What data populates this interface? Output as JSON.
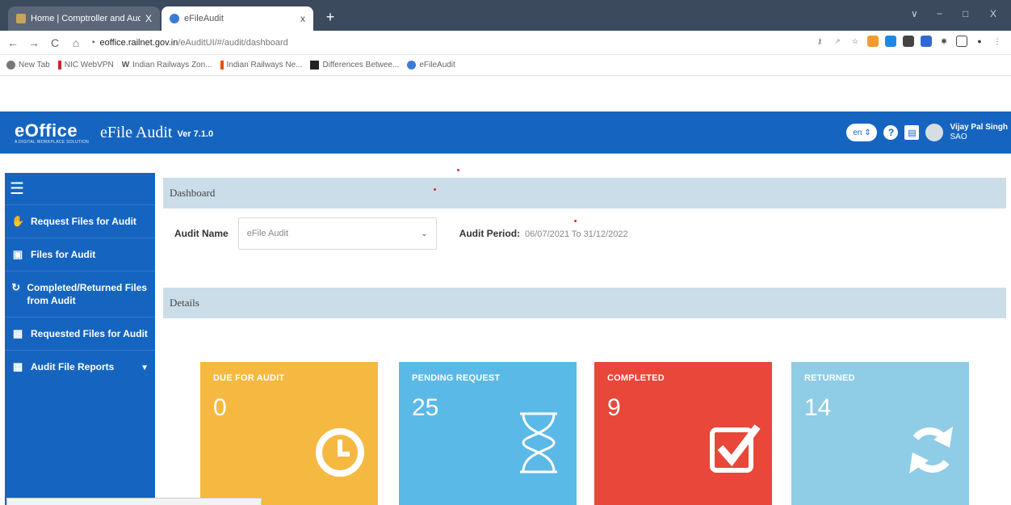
{
  "browser": {
    "tabs": [
      {
        "title": "Home | Comptroller and Auditor",
        "close": "X",
        "active": false
      },
      {
        "title": "eFileAudit",
        "close": "x",
        "active": true
      }
    ],
    "new_tab": "+",
    "window_controls": [
      "∨",
      "−",
      "□",
      "X"
    ],
    "address": {
      "lock": "🔒",
      "host": "eoffice.railnet.gov.in",
      "path": "/eAuditUI/#/audit/dashboard"
    },
    "bookmarks": [
      "New Tab",
      "NIC WebVPN",
      "Indian Railways Zon...",
      "Indian Railways Ne...",
      "Differences Betwee...",
      "eFileAudit"
    ]
  },
  "header": {
    "logo": "eOffice",
    "logo_tagline": "A DIGITAL WORKPLACE SOLUTION",
    "title": "eFile Audit",
    "version": "Ver 7.1.0",
    "language": "en ⇕",
    "help_icon": "?",
    "user_name": "Vijay Pal Singh",
    "user_role": "SAO"
  },
  "sidebar": {
    "items": [
      {
        "label": "Request Files for Audit",
        "icon": "hand-file-icon"
      },
      {
        "label": "Files for Audit",
        "icon": "file-icon"
      },
      {
        "label": "Completed/Returned Files from Audit",
        "icon": "refresh-icon"
      },
      {
        "label": "Requested Files for Audit",
        "icon": "document-icon"
      },
      {
        "label": "Audit File Reports",
        "icon": "report-icon",
        "caret": "▼"
      }
    ]
  },
  "dashboard": {
    "section_title": "Dashboard",
    "details_title": "Details",
    "audit_name_label": "Audit Name",
    "audit_name_value": "eFile Audit",
    "audit_period_label": "Audit Period:",
    "audit_period_value": "06/07/2021 To 31/12/2022",
    "tiles": [
      {
        "title": "DUE FOR AUDIT",
        "value": "0",
        "color": "#f5b942",
        "icon": "clock-icon"
      },
      {
        "title": "PENDING REQUEST",
        "value": "25",
        "color": "#5bb9e8",
        "icon": "hourglass-icon"
      },
      {
        "title": "COMPLETED",
        "value": "9",
        "color": "#e8473a",
        "icon": "checkbox-icon"
      },
      {
        "title": "RETURNED",
        "value": "14",
        "color": "#8fcce6",
        "icon": "refresh-icon"
      }
    ]
  }
}
